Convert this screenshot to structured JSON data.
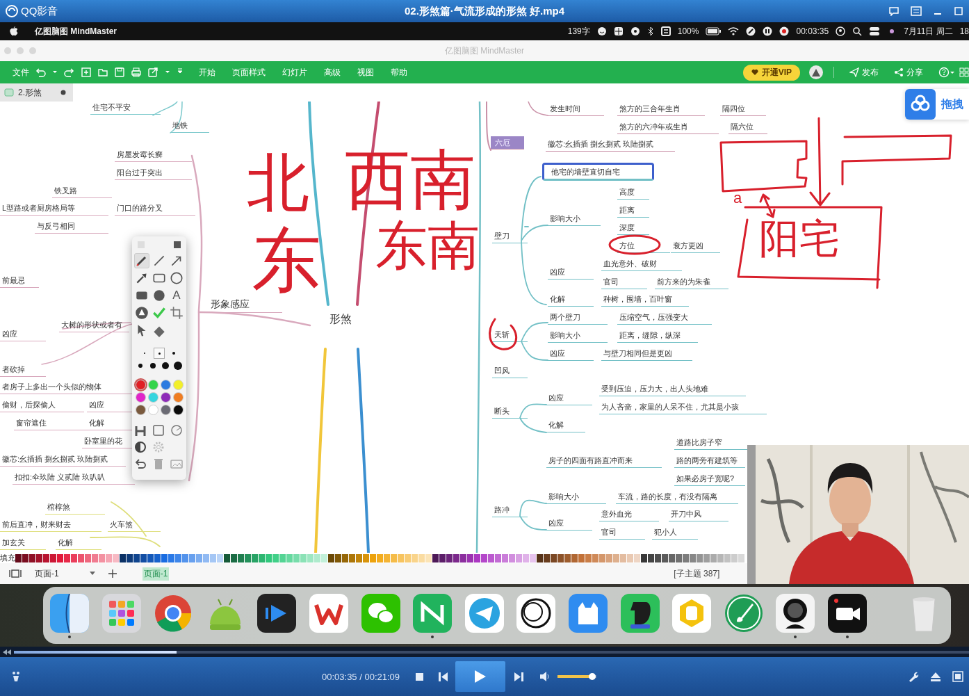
{
  "player": {
    "app_name": "QQ影音",
    "title": "02.形煞篇·气流形成的形煞 好.mp4"
  },
  "menubar": {
    "app": "亿图脑图 MindMaster",
    "word_count": "139字",
    "battery": "100%",
    "timer": "00:03:35",
    "date": "7月11日 周二",
    "time_partial": "18"
  },
  "window": {
    "title": "亿图脑图 MindMaster"
  },
  "toolbar": {
    "file": "文件",
    "menus": [
      "开始",
      "页面样式",
      "幻灯片",
      "高级",
      "视图",
      "帮助"
    ],
    "vip": "开通VIP",
    "publish": "发布",
    "share": "分享"
  },
  "document_tab": {
    "label": "2.形煞"
  },
  "mindmap": {
    "central": "形煞",
    "branches": [
      {
        "color": "#7cc9cc",
        "topics": [
          {
            "text": "住宅不平安",
            "kind": "plain"
          },
          {
            "text": "地铁",
            "kind": "plain"
          }
        ]
      },
      {
        "color": "#d9a9bd",
        "topics": [
          {
            "text": "房屋发霉长癣",
            "kind": "plain"
          },
          {
            "text": "阳台过于突出",
            "kind": "plain"
          },
          {
            "text": "铁叉路",
            "kind": "plain"
          },
          {
            "text": "L型路或者厨房格局等",
            "kind": "plain"
          },
          {
            "text": "门口的路分叉",
            "kind": "plain"
          },
          {
            "text": "与反弓相同",
            "kind": "plain"
          },
          {
            "text": "前最忌",
            "kind": "plain"
          },
          {
            "text": "形象感应",
            "kind": "major"
          },
          {
            "text": "大树的形状或者有",
            "kind": "plain"
          },
          {
            "text": "凶应",
            "kind": "plain"
          },
          {
            "text": "者砍掉",
            "kind": "plain"
          },
          {
            "text": "者房子上多出一个头似的物体",
            "kind": "plain"
          },
          {
            "text": "偷财，后探偷人",
            "kind": "plain"
          },
          {
            "text": "凶应",
            "kind": "plain"
          },
          {
            "text": "窗帘遮住",
            "kind": "plain"
          },
          {
            "text": "化解",
            "kind": "plain"
          },
          {
            "text": "卧室里的花",
            "kind": "plain"
          },
          {
            "text": "徽芯:幺插插 捌幺捌贰 玖陆捌贰",
            "kind": "plain"
          },
          {
            "text": "扣扣:伞玖陆 义贰陆 玖叭叭",
            "kind": "plain"
          }
        ]
      },
      {
        "color": "#dede7a",
        "topics": [
          {
            "text": "棺椁煞",
            "kind": "plain"
          },
          {
            "text": "前后直冲，财来财去",
            "kind": "plain"
          },
          {
            "text": "火车煞",
            "kind": "plain"
          },
          {
            "text": "加玄关",
            "kind": "plain"
          },
          {
            "text": "化解",
            "kind": "plain"
          }
        ]
      },
      {
        "color": "#c98fa6",
        "topics": [
          {
            "text": "发生时间",
            "kind": "plain"
          },
          {
            "text": "煞方的三合年生肖",
            "kind": "plain"
          },
          {
            "text": "隔四位",
            "kind": "plain"
          },
          {
            "text": "煞方的六冲年或生肖",
            "kind": "plain"
          },
          {
            "text": "隔六位",
            "kind": "plain"
          },
          {
            "text": "六厄",
            "kind": "filled"
          },
          {
            "text": "徽芯:幺插插 捌幺捌贰 玖陆捌贰",
            "kind": "plain"
          }
        ]
      },
      {
        "color": "#72c0c6",
        "topics": [
          {
            "text": "他宅的墙壁直切自宅",
            "kind": "outlined"
          },
          {
            "text": "高度",
            "kind": "plain"
          },
          {
            "text": "距离",
            "kind": "plain"
          },
          {
            "text": "影响大小",
            "kind": "plain"
          },
          {
            "text": "深度",
            "kind": "plain"
          },
          {
            "text": "壁刀",
            "kind": "plain"
          },
          {
            "text": "方位",
            "kind": "plain"
          },
          {
            "text": "衰方更凶",
            "kind": "plain"
          },
          {
            "text": "血光意外、破财",
            "kind": "plain"
          },
          {
            "text": "凶应",
            "kind": "plain"
          },
          {
            "text": "官司",
            "kind": "plain"
          },
          {
            "text": "前方来的为朱雀",
            "kind": "plain"
          },
          {
            "text": "化解",
            "kind": "plain"
          },
          {
            "text": "种树，围墙，百叶窗",
            "kind": "plain"
          },
          {
            "text": "两个壁刀",
            "kind": "plain"
          },
          {
            "text": "压缩空气，压强变大",
            "kind": "plain"
          },
          {
            "text": "天斩",
            "kind": "plain"
          },
          {
            "text": "影响大小",
            "kind": "plain"
          },
          {
            "text": "距离，缝隙，纵深",
            "kind": "plain"
          },
          {
            "text": "凶应",
            "kind": "plain"
          },
          {
            "text": "与壁刀相同但是更凶",
            "kind": "plain"
          },
          {
            "text": "凹风",
            "kind": "plain"
          },
          {
            "text": "受到压迫，压力大，出人头地难",
            "kind": "plain"
          },
          {
            "text": "凶应",
            "kind": "plain"
          },
          {
            "text": "为人吝啬，家里的人呆不住，尤其是小孩",
            "kind": "plain"
          },
          {
            "text": "断头",
            "kind": "plain"
          },
          {
            "text": "化解",
            "kind": "plain"
          },
          {
            "text": "道路比房子窄",
            "kind": "plain"
          },
          {
            "text": "房子的四面有路直冲而来",
            "kind": "plain"
          },
          {
            "text": "路的两旁有建筑等",
            "kind": "plain"
          },
          {
            "text": "如果必房子宽呢?",
            "kind": "plain"
          },
          {
            "text": "影响大小",
            "kind": "plain"
          },
          {
            "text": "车流，路的长度，有没有隔离",
            "kind": "plain"
          },
          {
            "text": "路冲",
            "kind": "plain"
          },
          {
            "text": "意外血光",
            "kind": "plain"
          },
          {
            "text": "开刀中风",
            "kind": "plain"
          },
          {
            "text": "凶应",
            "kind": "plain"
          },
          {
            "text": "官司",
            "kind": "plain"
          },
          {
            "text": "犯小人",
            "kind": "plain"
          }
        ]
      }
    ],
    "annotations": [
      {
        "text": "北"
      },
      {
        "text": "东"
      },
      {
        "text": "西南"
      },
      {
        "text": "东南"
      },
      {
        "text": "a"
      },
      {
        "text": "阳宅"
      }
    ]
  },
  "drag_widget": {
    "label": "拖拽"
  },
  "pen_toolbar": {
    "tools": [
      {
        "kind": "pencil",
        "selected": true
      },
      {
        "kind": "line",
        "selected": false
      },
      {
        "kind": "arrow",
        "selected": false
      },
      {
        "kind": "pointer-arrow",
        "selected": false
      },
      {
        "kind": "rectangle",
        "selected": false
      },
      {
        "kind": "circle",
        "selected": false
      },
      {
        "kind": "filled-rectangle",
        "selected": false
      },
      {
        "kind": "filled-circle",
        "selected": false
      },
      {
        "kind": "text",
        "label": "A",
        "selected": false
      },
      {
        "kind": "shapes",
        "selected": false
      },
      {
        "kind": "check",
        "selected": false
      },
      {
        "kind": "crop",
        "selected": false
      },
      {
        "kind": "select",
        "selected": false
      },
      {
        "kind": "eraser",
        "selected": false
      }
    ],
    "brush_sizes": [
      {
        "selected": false
      },
      {
        "selected": true
      },
      {
        "selected": false
      },
      {
        "selected": false
      },
      {
        "selected": false
      },
      {
        "selected": false
      },
      {
        "selected": false
      }
    ],
    "colors": [
      {
        "color": "#e01f25",
        "selected": true
      },
      {
        "color": "#33d44a",
        "selected": false
      },
      {
        "color": "#2d7be0",
        "selected": false
      },
      {
        "color": "#f2ef2a",
        "selected": false
      },
      {
        "color": "#e026c8",
        "selected": false
      },
      {
        "color": "#35d5df",
        "selected": false
      },
      {
        "color": "#8e2cb8",
        "selected": false
      },
      {
        "color": "#ef7d22",
        "selected": false
      },
      {
        "color": "#7a5a3e",
        "selected": false
      },
      {
        "color": "#ffffff",
        "selected": false
      },
      {
        "color": "#6b6b74",
        "selected": false
      },
      {
        "color": "#0a0a0a",
        "selected": false
      }
    ]
  },
  "palette": {
    "label": "填充"
  },
  "status_bar": {
    "page_select": "页面-1",
    "page_tabs": [
      {
        "label": "页面-1",
        "selected": true
      }
    ],
    "topic_count": "[子主题 387]"
  },
  "dock": {
    "apps": [
      {
        "kind": "finder",
        "running": true
      },
      {
        "kind": "launchpad",
        "running": false
      },
      {
        "kind": "browser",
        "running": false
      },
      {
        "kind": "android",
        "running": false
      },
      {
        "kind": "player",
        "running": false
      },
      {
        "kind": "office",
        "running": false
      },
      {
        "kind": "chat",
        "running": false
      },
      {
        "kind": "mindmap",
        "running": true
      },
      {
        "kind": "telegram",
        "running": false
      },
      {
        "kind": "circles",
        "running": false
      },
      {
        "kind": "cat",
        "running": false
      },
      {
        "kind": "notes",
        "running": false
      },
      {
        "kind": "hexagon",
        "running": false
      },
      {
        "kind": "brush",
        "running": false
      },
      {
        "kind": "webcam",
        "running": true
      },
      {
        "kind": "recorder",
        "running": true
      },
      {
        "kind": "trash",
        "running": false
      }
    ]
  },
  "controls": {
    "progress": {
      "level": 0.17
    },
    "time": "00:03:35 / 00:21:09",
    "volume": {
      "level": 0.9
    }
  }
}
